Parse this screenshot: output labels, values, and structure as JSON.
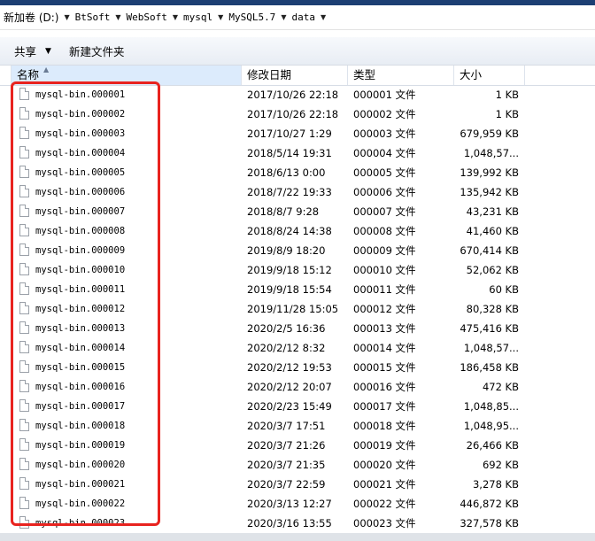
{
  "address": {
    "path": [
      "新加卷 (D:)",
      "BtSoft",
      "WebSoft",
      "mysql",
      "MySQL5.7",
      "data"
    ]
  },
  "toolbar": {
    "share_label": "共享",
    "new_folder_label": "新建文件夹"
  },
  "columns": {
    "name": "名称",
    "date": "修改日期",
    "type": "类型",
    "size": "大小"
  },
  "files": [
    {
      "name": "mysql-bin.000001",
      "date": "2017/10/26 22:18",
      "type": "000001 文件",
      "size": "1 KB"
    },
    {
      "name": "mysql-bin.000002",
      "date": "2017/10/26 22:18",
      "type": "000002 文件",
      "size": "1 KB"
    },
    {
      "name": "mysql-bin.000003",
      "date": "2017/10/27 1:29",
      "type": "000003 文件",
      "size": "679,959 KB"
    },
    {
      "name": "mysql-bin.000004",
      "date": "2018/5/14 19:31",
      "type": "000004 文件",
      "size": "1,048,57..."
    },
    {
      "name": "mysql-bin.000005",
      "date": "2018/6/13 0:00",
      "type": "000005 文件",
      "size": "139,992 KB"
    },
    {
      "name": "mysql-bin.000006",
      "date": "2018/7/22 19:33",
      "type": "000006 文件",
      "size": "135,942 KB"
    },
    {
      "name": "mysql-bin.000007",
      "date": "2018/8/7 9:28",
      "type": "000007 文件",
      "size": "43,231 KB"
    },
    {
      "name": "mysql-bin.000008",
      "date": "2018/8/24 14:38",
      "type": "000008 文件",
      "size": "41,460 KB"
    },
    {
      "name": "mysql-bin.000009",
      "date": "2019/8/9 18:20",
      "type": "000009 文件",
      "size": "670,414 KB"
    },
    {
      "name": "mysql-bin.000010",
      "date": "2019/9/18 15:12",
      "type": "000010 文件",
      "size": "52,062 KB"
    },
    {
      "name": "mysql-bin.000011",
      "date": "2019/9/18 15:54",
      "type": "000011 文件",
      "size": "60 KB"
    },
    {
      "name": "mysql-bin.000012",
      "date": "2019/11/28 15:05",
      "type": "000012 文件",
      "size": "80,328 KB"
    },
    {
      "name": "mysql-bin.000013",
      "date": "2020/2/5 16:36",
      "type": "000013 文件",
      "size": "475,416 KB"
    },
    {
      "name": "mysql-bin.000014",
      "date": "2020/2/12 8:32",
      "type": "000014 文件",
      "size": "1,048,57..."
    },
    {
      "name": "mysql-bin.000015",
      "date": "2020/2/12 19:53",
      "type": "000015 文件",
      "size": "186,458 KB"
    },
    {
      "name": "mysql-bin.000016",
      "date": "2020/2/12 20:07",
      "type": "000016 文件",
      "size": "472 KB"
    },
    {
      "name": "mysql-bin.000017",
      "date": "2020/2/23 15:49",
      "type": "000017 文件",
      "size": "1,048,85..."
    },
    {
      "name": "mysql-bin.000018",
      "date": "2020/3/7 17:51",
      "type": "000018 文件",
      "size": "1,048,95..."
    },
    {
      "name": "mysql-bin.000019",
      "date": "2020/3/7 21:26",
      "type": "000019 文件",
      "size": "26,466 KB"
    },
    {
      "name": "mysql-bin.000020",
      "date": "2020/3/7 21:35",
      "type": "000020 文件",
      "size": "692 KB"
    },
    {
      "name": "mysql-bin.000021",
      "date": "2020/3/7 22:59",
      "type": "000021 文件",
      "size": "3,278 KB"
    },
    {
      "name": "mysql-bin.000022",
      "date": "2020/3/13 12:27",
      "type": "000022 文件",
      "size": "446,872 KB"
    },
    {
      "name": "mysql-bin.000023",
      "date": "2020/3/16 13:55",
      "type": "000023 文件",
      "size": "327,578 KB"
    }
  ],
  "colors": {
    "highlight": "#e8231f",
    "sorted_column": "#dcebfc"
  }
}
